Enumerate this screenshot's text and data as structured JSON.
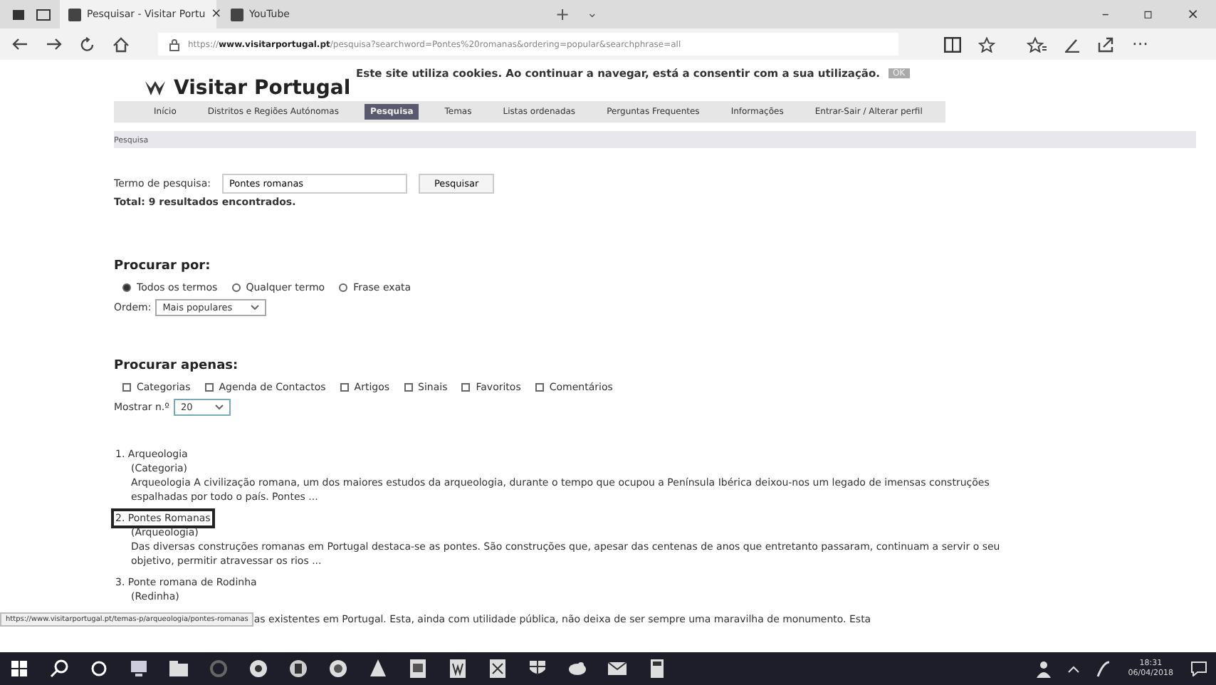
{
  "browser": {
    "tabs": [
      {
        "label": "Pesquisar - Visitar Portu",
        "close": "×",
        "selected": true
      },
      {
        "label": "YouTube",
        "selected": false
      }
    ],
    "new_tab": "+",
    "tab_menu": "⌄",
    "window_controls": [
      "–",
      "▫",
      "×"
    ],
    "address": {
      "prefix": "https://",
      "domain": "www.visitarportugal.pt",
      "path": "/pesquisa?searchword=Pontes%20romanas&ordering=popular&searchphrase=all"
    },
    "more": "···"
  },
  "cookie_notice": {
    "text": "Este site utiliza cookies. Ao continuar a navegar, está a consentir com a sua utilização.",
    "button": "OK"
  },
  "site": {
    "logo": "Visitar Portugal",
    "nav": [
      {
        "label": "Início",
        "selected": false
      },
      {
        "label": "Distritos e Regiões Autónomas",
        "selected": false
      },
      {
        "label": "Pesquisa",
        "selected": true
      },
      {
        "label": "Temas",
        "selected": false
      },
      {
        "label": "Listas ordenadas",
        "selected": false
      },
      {
        "label": "Perguntas Frequentes",
        "selected": false
      },
      {
        "label": "Informações",
        "selected": false
      },
      {
        "label": "Entrar-Sair / Alterar perfil",
        "selected": false
      }
    ],
    "breadcrumb": "Pesquisa"
  },
  "search": {
    "label": "Termo de pesquisa:",
    "value": "Pontes romanas",
    "button": "Pesquisar",
    "total": "Total: 9 resultados encontrados."
  },
  "search_by": {
    "heading": "Procurar por:",
    "options": [
      {
        "label": "Todos os termos",
        "selected": true
      },
      {
        "label": "Qualquer termo",
        "selected": false
      },
      {
        "label": "Frase exata",
        "selected": false
      }
    ],
    "order_label": "Ordem:",
    "order_value": "Mais populares"
  },
  "search_only": {
    "heading": "Procurar apenas:",
    "options": [
      {
        "label": "Categorias",
        "checked": false
      },
      {
        "label": "Agenda de Contactos",
        "checked": false
      },
      {
        "label": "Artigos",
        "checked": false
      },
      {
        "label": "Sinais",
        "checked": false
      },
      {
        "label": "Favoritos",
        "checked": false
      },
      {
        "label": "Comentários",
        "checked": false
      }
    ],
    "count_label": "Mostrar n.º",
    "count_value": "20"
  },
  "results": [
    {
      "title": "1. Arqueologia",
      "category": "(Categoria)",
      "snippet": "Arqueologia A civilização romana, um dos maiores estudos da arqueologia, durante o tempo que ocupou a Península Ibérica deixou-nos um legado de imensas construções espalhadas por todo o país. Pontes ...",
      "highlighted": false
    },
    {
      "title": "2. Pontes Romanas",
      "category": "(Arqueologia)",
      "snippet": "Das diversas construções romanas em Portugal destaca-se as pontes. São construções que, apesar das centenas de anos que entretanto passaram, continuam a servir o seu objetivo, permitir atravessar os rios ...",
      "highlighted": true
    },
    {
      "title": "3. Ponte romana de Rodinha",
      "category": "(Redinha)",
      "snippet": "as existentes em Portugal. Esta, ainda com utilidade pública, não deixa de ser sempre uma maravilha de monumento. Esta",
      "highlighted": false
    }
  ],
  "status_url": "https://www.visitarportugal.pt/temas-p/arqueologia/pontes-romanas",
  "taskbar": {
    "time": "18:31",
    "date": "06/04/2018"
  }
}
